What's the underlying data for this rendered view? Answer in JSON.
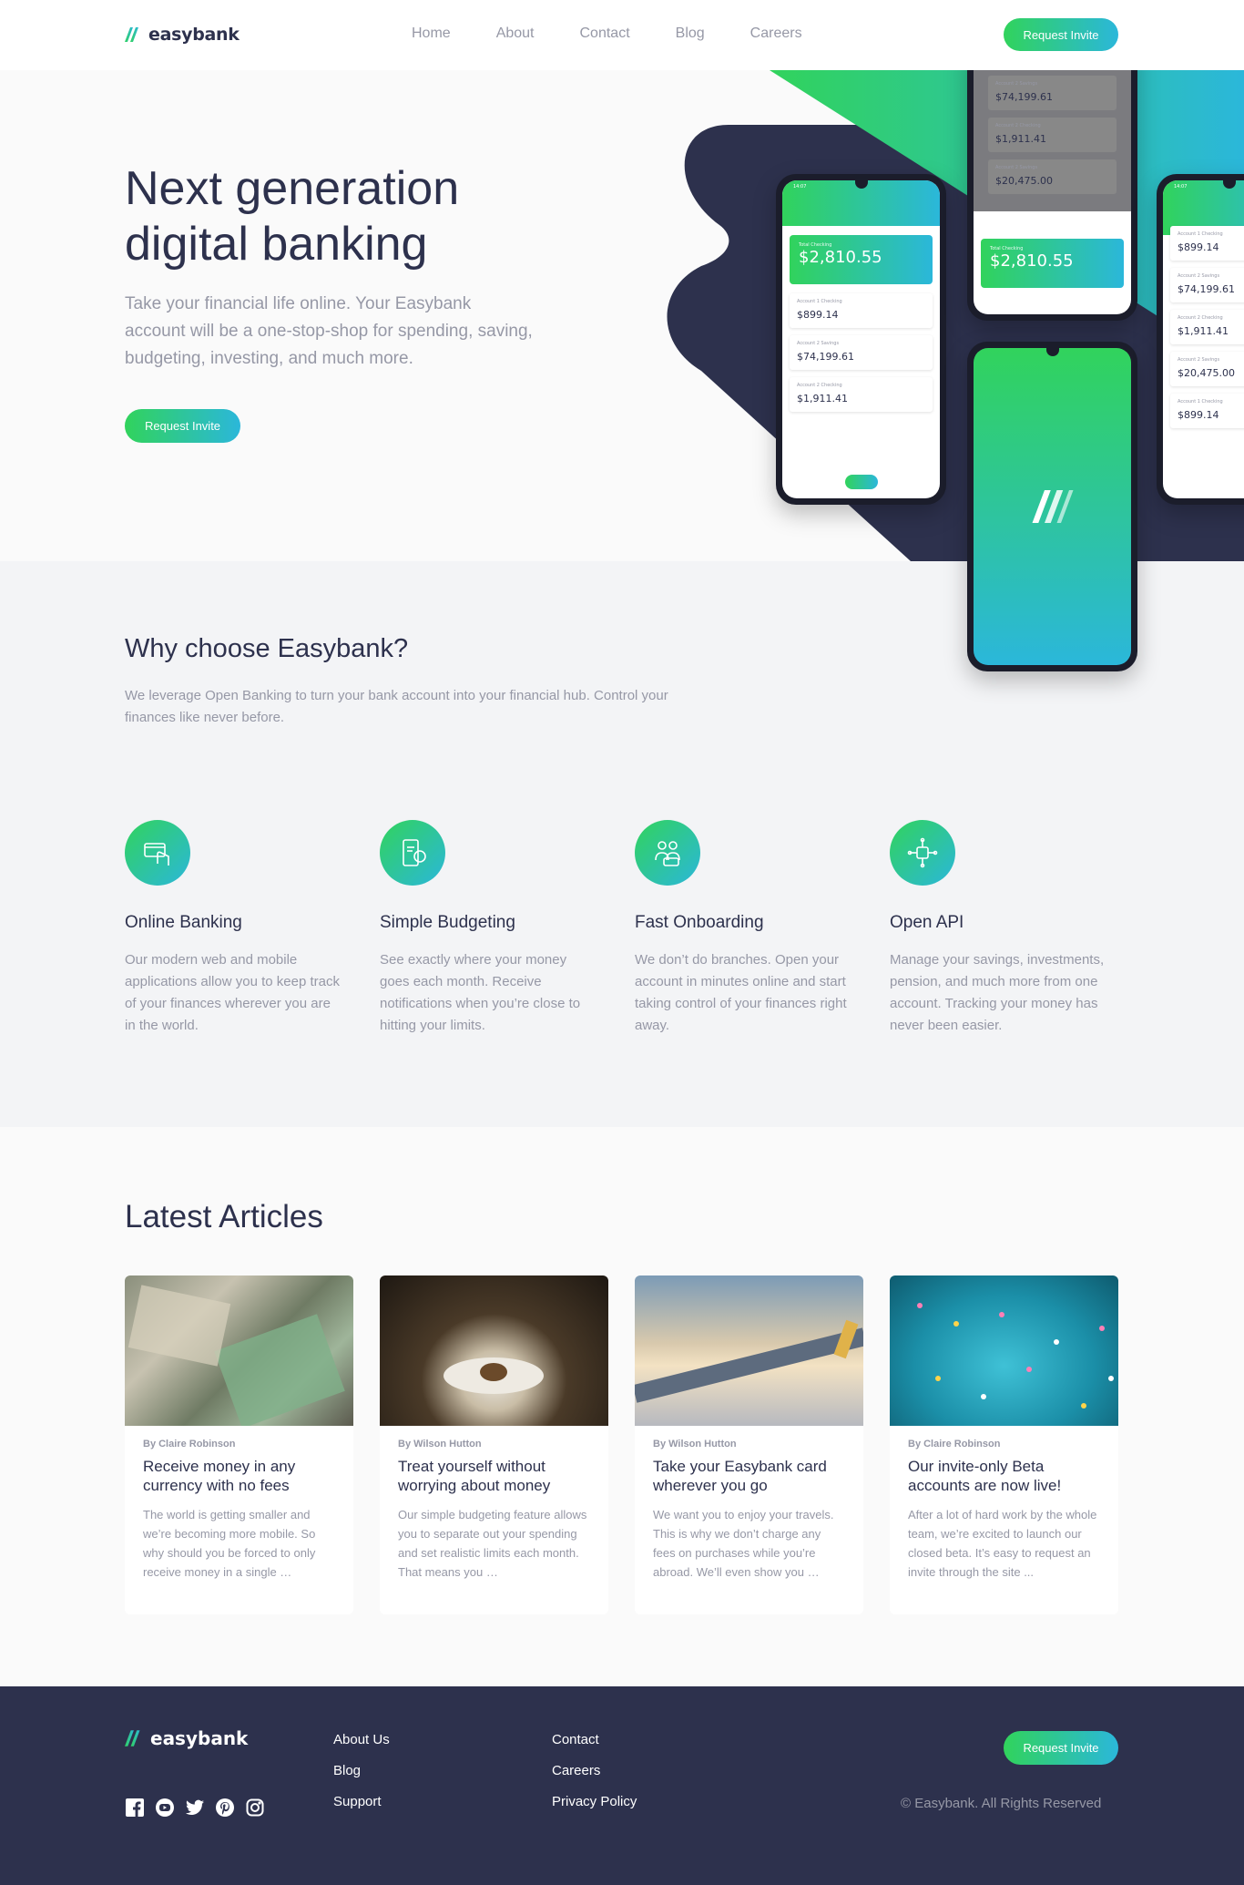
{
  "brand": {
    "name": "easybank",
    "accent": "#31d35c",
    "accent2": "#2bb7da",
    "navy": "#2d314d"
  },
  "nav": [
    "Home",
    "About",
    "Contact",
    "Blog",
    "Careers"
  ],
  "header": {
    "cta": "Request Invite"
  },
  "hero": {
    "title": "Next generation digital banking",
    "text": "Take your financial life online. Your Easybank account will be a one-stop-shop for spending, saving, budgeting, investing, and much more.",
    "cta": "Request Invite"
  },
  "phones": {
    "status_time": "14:07",
    "total_label": "Total Checking",
    "total": "$2,810.55",
    "accounts": [
      {
        "label": "Account 1 Checking",
        "amount": "$899.14"
      },
      {
        "label": "Account 2 Savings",
        "amount": "$74,199.61"
      },
      {
        "label": "Account 2 Checking",
        "amount": "$1,911.41"
      },
      {
        "label": "Account 2 Savings",
        "amount": "$20,475.00"
      }
    ]
  },
  "why": {
    "title": "Why choose Easybank?",
    "text": "We leverage Open Banking to turn your bank account into your financial hub. Control your finances like never before.",
    "features": [
      {
        "icon": "online-banking-icon",
        "title": "Online Banking",
        "text": "Our modern web and mobile applications allow you to keep track of your finances wherever you are in the world."
      },
      {
        "icon": "budgeting-icon",
        "title": "Simple Budgeting",
        "text": "See exactly where your money goes each month. Receive notifications when you’re close to hitting your limits."
      },
      {
        "icon": "onboarding-icon",
        "title": "Fast Onboarding",
        "text": "We don’t do branches. Open your account in minutes online and start taking control of your finances right away."
      },
      {
        "icon": "api-icon",
        "title": "Open API",
        "text": "Manage your savings, investments, pension, and much more from one account. Tracking your money has never been easier."
      }
    ]
  },
  "articles": {
    "title": "Latest Articles",
    "items": [
      {
        "image": "currency-photo",
        "author": "By Claire Robinson",
        "title": "Receive money in any currency with no fees",
        "text": "The world is getting smaller and we’re becoming more mobile. So why should you be forced to only receive money in a single …"
      },
      {
        "image": "restaurant-photo",
        "author": "By Wilson Hutton",
        "title": "Treat yourself without worrying about money",
        "text": "Our simple budgeting feature allows you to separate out your spending and set realistic limits each month. That means you …"
      },
      {
        "image": "plane-photo",
        "author": "By Wilson Hutton",
        "title": "Take your Easybank card wherever you go",
        "text": "We want you to enjoy your travels. This is why we don’t charge any fees on purchases while you’re abroad. We’ll even show you …"
      },
      {
        "image": "confetti-photo",
        "author": "By Claire Robinson",
        "title": "Our invite-only Beta accounts are now live!",
        "text": "After a lot of hard work by the whole team, we’re excited to launch our closed beta. It’s easy to request an invite through the site ..."
      }
    ]
  },
  "footer": {
    "col1": [
      "About Us",
      "Blog",
      "Support"
    ],
    "col2": [
      "Contact",
      "Careers",
      "Privacy Policy"
    ],
    "cta": "Request Invite",
    "copyright": "© Easybank. All Rights Reserved",
    "socials": [
      "facebook-icon",
      "youtube-icon",
      "twitter-icon",
      "pinterest-icon",
      "instagram-icon"
    ]
  }
}
